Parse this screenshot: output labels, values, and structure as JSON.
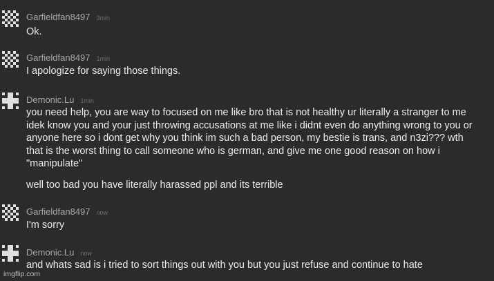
{
  "messages": [
    {
      "author": "Garfieldfan8497",
      "time": "3min",
      "avatar": "checker-avatar-icon",
      "lines": [
        "Ok."
      ]
    },
    {
      "author": "Garfieldfan8497",
      "time": "1min",
      "avatar": "checker-avatar-icon",
      "lines": [
        "I apologize for saying those things."
      ]
    },
    {
      "author": "Demonic.Lu",
      "time": "1min",
      "avatar": "plus-avatar-icon",
      "lines": [
        "you need help, you are way to focused on me like bro that is not healthy ur literally a stranger to me\nidek know you and your just throwing accusations at me like i didnt even do anything wrong to you or\nanyone here so i dont get why you think im such a bad person, my bestie is trans, and n3zi??? wth\nthat is the worst thing to call someone who is german, and give me one good reason on how i\n\"manipulate\"",
        "well too bad you have literally harassed ppl and its terrible"
      ]
    },
    {
      "author": "Garfieldfan8497",
      "time": "now",
      "avatar": "checker-avatar-icon",
      "lines": [
        "I'm sorry"
      ]
    },
    {
      "author": "Demonic.Lu",
      "time": "now",
      "avatar": "plus-avatar-icon",
      "lines": [
        "and whats sad is i tried to sort things out with you but you just refuse and continue to hate"
      ]
    }
  ],
  "watermark": "imgflip.com",
  "colors": {
    "background": "#2b2b2b",
    "author": "#a8a8a8",
    "time": "#6f6f6f",
    "text": "#ececec"
  }
}
